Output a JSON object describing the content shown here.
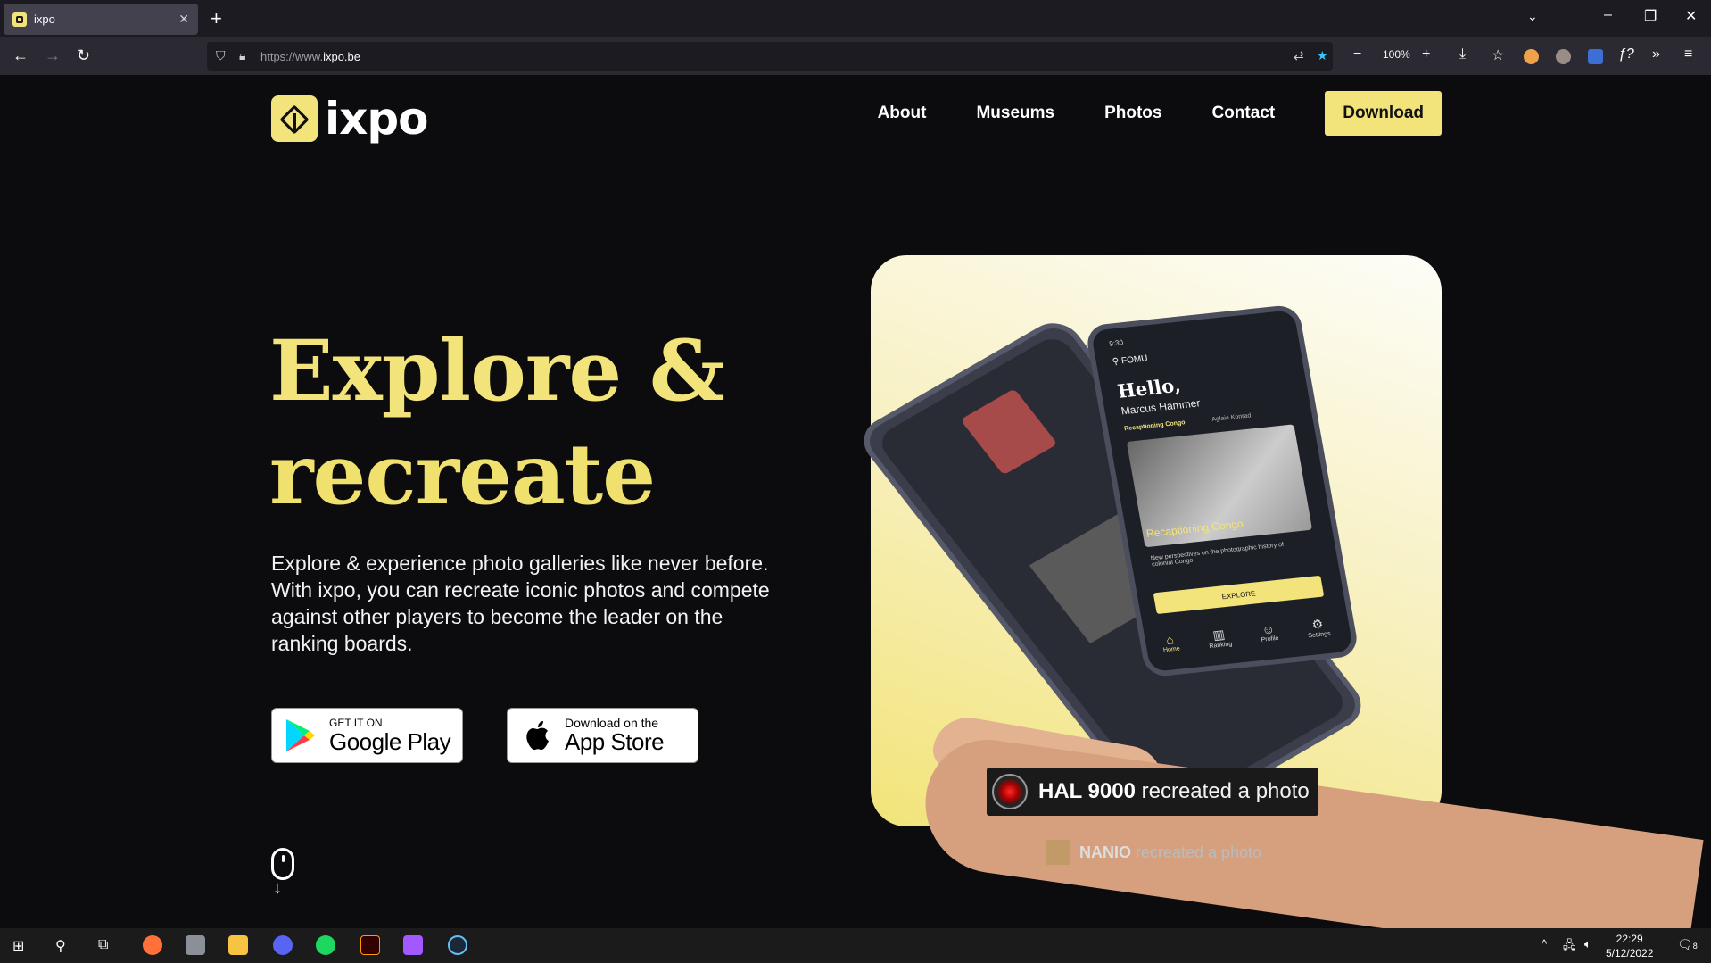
{
  "browser": {
    "tab_title": "ixpo",
    "tab_close": "✕",
    "new_tab": "+",
    "url_prefix": "https://www.",
    "url_host": "ixpo.be",
    "zoom": "100%"
  },
  "header": {
    "logo_text": "ixpo",
    "nav": [
      {
        "label": "About"
      },
      {
        "label": "Museums"
      },
      {
        "label": "Photos"
      },
      {
        "label": "Contact"
      }
    ],
    "download_label": "Download"
  },
  "hero": {
    "title_line1": "Explore &",
    "title_line2": "recreate",
    "description": "Explore & experience photo galleries like never before. With ixpo, you can recreate iconic photos and compete against other players to become the leader on the ranking boards.",
    "google_play": {
      "small": "GET IT ON",
      "big": "Google Play"
    },
    "app_store": {
      "small": "Download on the",
      "big": "App Store"
    }
  },
  "phone": {
    "time": "9:30",
    "location": "FOMU",
    "greeting": "Hello,",
    "user": "Marcus Hammer",
    "tab_active": "Recaptioning Congo",
    "tab_other": "Aglaia Konrad",
    "caption": "Recaptioning Congo",
    "subcaption": "New perspectives on the photographic history of colonial Congo",
    "explore": "EXPLORE",
    "bottom_nav": [
      "Home",
      "Ranking",
      "Profile",
      "Settings"
    ]
  },
  "notifications": {
    "main_name": "HAL 9000",
    "main_action": " recreated a photo",
    "sub_name": "NANIO",
    "sub_action": " recreated a photo"
  },
  "taskbar": {
    "time": "22:29",
    "date": "5/12/2022",
    "notification_count": "8"
  },
  "colors": {
    "accent": "#f2e47a",
    "page_bg": "#0c0c0e"
  }
}
